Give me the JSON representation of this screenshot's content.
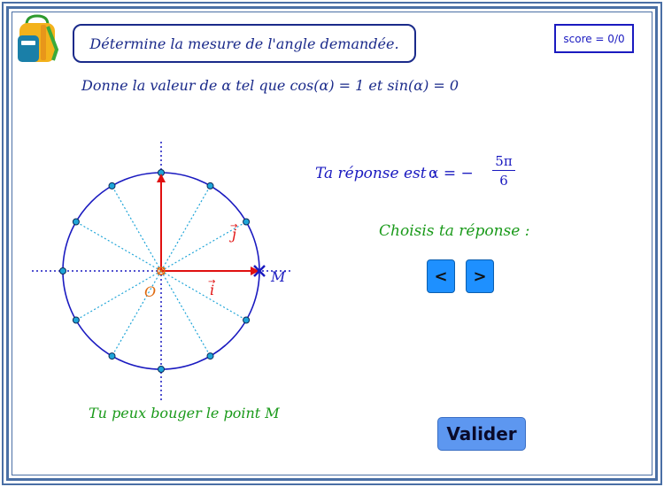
{
  "header": {
    "title": "Détermine la mesure de l'angle demandée.",
    "score": "score = 0/0"
  },
  "question": "Donne la valeur de α tel que cos(α) = 1 et sin(α) = 0",
  "answer": {
    "label": "Ta réponse est :",
    "prefix": "α = −",
    "numerator": "5π",
    "denominator": "6"
  },
  "controls": {
    "choose_label": "Choisis ta réponse :",
    "prev_label": "<",
    "next_label": ">",
    "submit_label": "Valider"
  },
  "circle": {
    "origin_label": "O",
    "i_label": "i",
    "j_label": "j",
    "point_label": "M",
    "hint": "Tu peux bouger le point M",
    "colors": {
      "circle": "#1a1ac0",
      "axis": "#1a1ac0",
      "vector": "#e01010",
      "radius": "#1fa5d8",
      "origin": "#e06a10"
    }
  },
  "icons": {
    "app_icon": "backpack-icon"
  }
}
